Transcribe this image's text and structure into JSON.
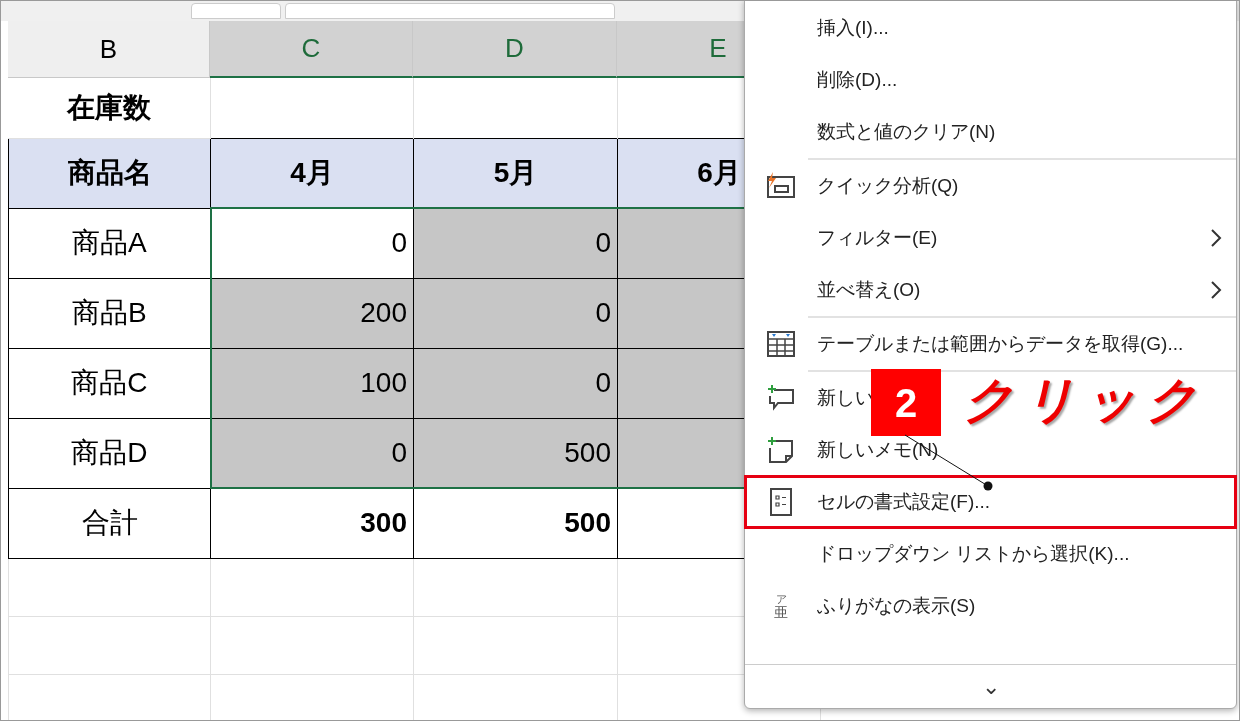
{
  "sheet": {
    "columns": [
      {
        "label": "B",
        "selected": false
      },
      {
        "label": "C",
        "selected": true
      },
      {
        "label": "D",
        "selected": true
      },
      {
        "label": "E",
        "selected": true
      }
    ],
    "title_cell": "在庫数",
    "header_row": [
      "商品名",
      "4月",
      "5月",
      "6月"
    ],
    "rows": [
      {
        "cells": [
          {
            "value": "商品A",
            "selected": false
          },
          {
            "value": "0",
            "selected": false
          },
          {
            "value": "0",
            "selected": true
          },
          {
            "selected": true
          }
        ]
      },
      {
        "cells": [
          {
            "value": "商品B",
            "selected": false
          },
          {
            "value": "200",
            "selected": true
          },
          {
            "value": "0",
            "selected": true
          },
          {
            "selected": true
          }
        ]
      },
      {
        "cells": [
          {
            "value": "商品C",
            "selected": false
          },
          {
            "value": "100",
            "selected": true
          },
          {
            "value": "0",
            "selected": true
          },
          {
            "selected": true
          }
        ]
      },
      {
        "cells": [
          {
            "value": "商品D",
            "selected": false
          },
          {
            "value": "0",
            "selected": true
          },
          {
            "value": "500",
            "selected": true
          },
          {
            "selected": true
          }
        ]
      }
    ],
    "total_row": {
      "cells": [
        {
          "value": "合計"
        },
        {
          "value": "300"
        },
        {
          "value": "500"
        },
        {}
      ]
    }
  },
  "context_menu": {
    "items": [
      {
        "kind": "item",
        "label": "挿入(I)...",
        "submenu": false,
        "highlighted": false
      },
      {
        "kind": "item",
        "label": "削除(D)...",
        "submenu": false,
        "highlighted": false
      },
      {
        "kind": "item",
        "label": "数式と値のクリア(N)",
        "submenu": false,
        "highlighted": false
      },
      {
        "kind": "separator"
      },
      {
        "kind": "item",
        "label": "クイック分析(Q)",
        "submenu": false,
        "highlighted": false
      },
      {
        "kind": "item",
        "label": "フィルター(E)",
        "submenu": true,
        "highlighted": false
      },
      {
        "kind": "item",
        "label": "並べ替え(O)",
        "submenu": true,
        "highlighted": false
      },
      {
        "kind": "separator"
      },
      {
        "kind": "item",
        "label": "テーブルまたは範囲からデータを取得(G)...",
        "submenu": false,
        "highlighted": false
      },
      {
        "kind": "separator"
      },
      {
        "kind": "item",
        "label": "新しい",
        "submenu": false,
        "highlighted": false
      },
      {
        "kind": "item",
        "label": "新しいメモ(N)",
        "submenu": false,
        "highlighted": false
      },
      {
        "kind": "item",
        "label": "セルの書式設定(F)...",
        "submenu": false,
        "highlighted": true
      },
      {
        "kind": "item",
        "label": "ドロップダウン リストから選択(K)...",
        "submenu": false,
        "highlighted": false
      },
      {
        "kind": "item",
        "glyph_top": "ア",
        "glyph_bottom": "亜",
        "label": "ふりがなの表示(S)",
        "submenu": false,
        "highlighted": false
      }
    ],
    "more": "⌄"
  },
  "callout": {
    "badge": "2",
    "label": "クリック"
  }
}
